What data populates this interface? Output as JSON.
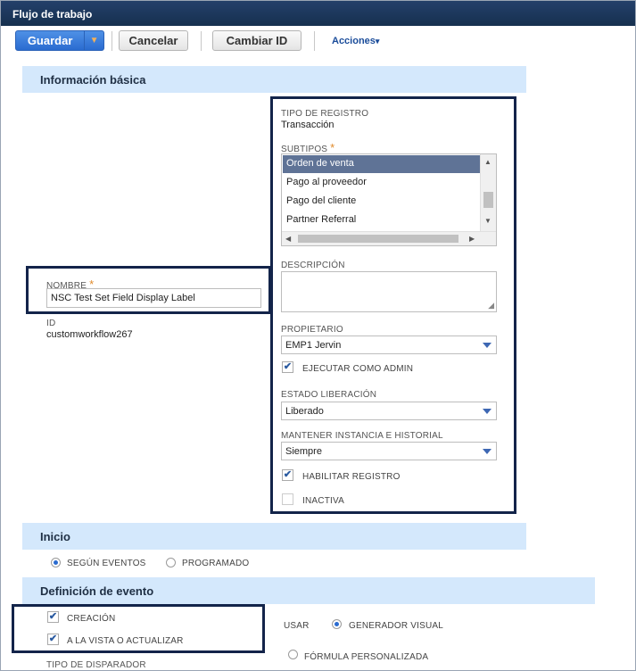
{
  "window": {
    "title": "Flujo de trabajo"
  },
  "toolbar": {
    "save_label": "Guardar",
    "save_menu_icon": "▼",
    "cancel_label": "Cancelar",
    "change_id_label": "Cambiar ID",
    "actions_label": "Acciones",
    "actions_caret": "▾"
  },
  "basic_info": {
    "heading": "Información básica",
    "name_label": "NOMBRE",
    "required_mark": "*",
    "name_value": "NSC Test Set Field Display Label",
    "id_label": "ID",
    "id_value": "customworkflow267",
    "record_type_label": "TIPO DE REGISTRO",
    "record_type_value": "Transacción",
    "subtypes_label": "SUBTIPOS",
    "subtypes": [
      "Orden de venta",
      "Pago al proveedor",
      "Pago del cliente",
      "Partner Referral"
    ],
    "subtypes_selected": "Orden de venta",
    "description_label": "DESCRIPCIÓN",
    "description_value": "",
    "owner_label": "PROPIETARIO",
    "owner_value": "EMP1 Jervin",
    "run_as_admin_label": "EJECUTAR COMO ADMIN",
    "run_as_admin_checked": true,
    "release_status_label": "ESTADO LIBERACIÓN",
    "release_status_value": "Liberado",
    "keep_instance_label": "MANTENER INSTANCIA E HISTORIAL",
    "keep_instance_value": "Siempre",
    "enable_logging_label": "HABILITAR REGISTRO",
    "enable_logging_checked": true,
    "inactive_label": "INACTIVA",
    "inactive_checked": false
  },
  "start": {
    "heading": "Inicio",
    "options": [
      "SEGÚN EVENTOS",
      "PROGRAMADO"
    ],
    "selected": "SEGÚN EVENTOS"
  },
  "event_definition": {
    "heading": "Definición de evento",
    "on_create_label": "CREACIÓN",
    "on_create_checked": true,
    "on_view_update_label": "A LA VISTA O ACTUALIZAR",
    "on_view_update_checked": true,
    "trigger_type_label": "TIPO DE DISPARADOR",
    "use_label": "USAR",
    "use_options": [
      "GENERADOR VISUAL",
      "FÓRMULA PERSONALIZADA"
    ],
    "use_selected": "GENERADOR VISUAL"
  },
  "icons": {
    "check": "✔",
    "scroll_up": "▲",
    "scroll_down": "▼",
    "scroll_left": "◀",
    "scroll_right": "▶",
    "resize_grip": "◢"
  },
  "colors": {
    "titlebar": "#16304f",
    "primary_button": "#2a6bd0",
    "section_bar": "#d4e8fc",
    "highlight_box": "#13244a",
    "required": "#e08a2b"
  }
}
